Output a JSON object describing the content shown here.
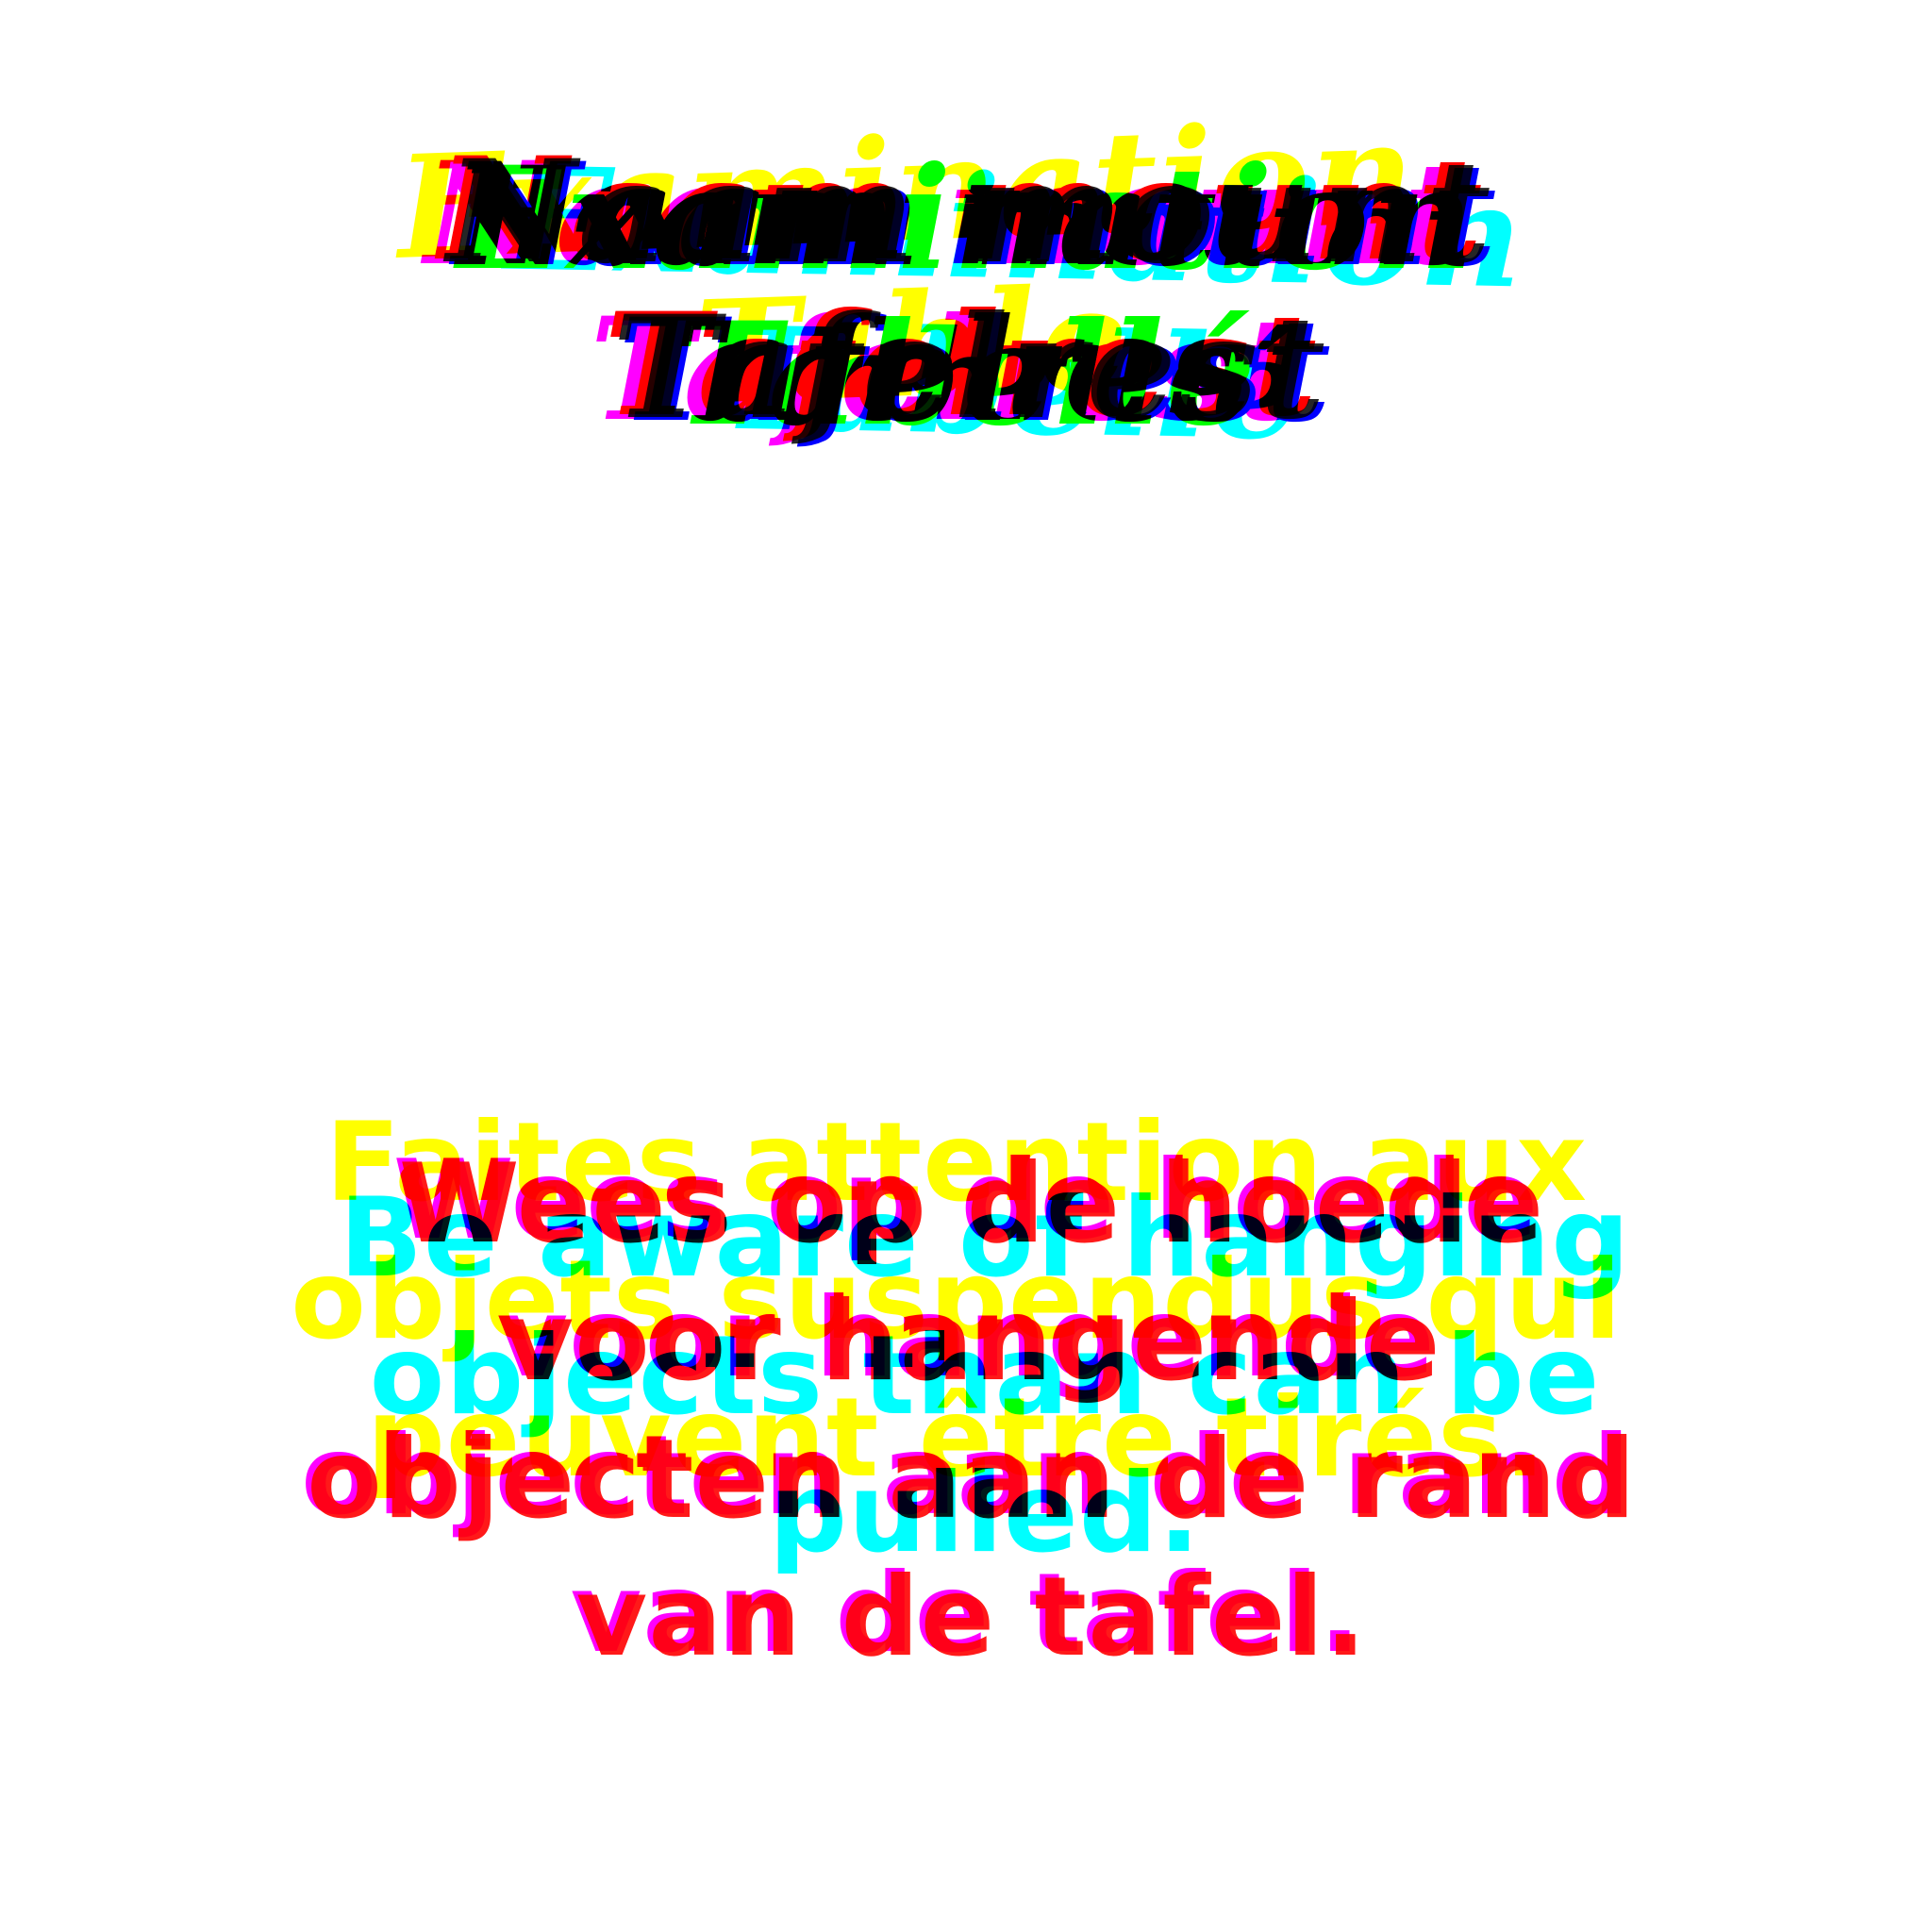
{
  "title_layers": [
    {
      "lang": "en",
      "line1": "Examination",
      "line2": "Table"
    },
    {
      "lang": "fr",
      "line1": "Examination",
      "line2": "Tabellé"
    },
    {
      "lang": "nl",
      "line1": "Naam mount",
      "line2": "Tafelrest"
    }
  ],
  "warnings": {
    "fr": "Faites attention aux objets suspendus qui peuvent être tirés.",
    "en": "Be aware of hanging objects than can be pulled.",
    "nl": "Wees op de hoede voor hangende objecten aan de rand van de tafel."
  },
  "colors": {
    "yellow": "#ffff00",
    "cyan": "#00ffff",
    "magenta": "#ff00ff",
    "red": "#ff0000",
    "blue": "#0000ff",
    "green": "#00ff00",
    "black": "#000000"
  }
}
